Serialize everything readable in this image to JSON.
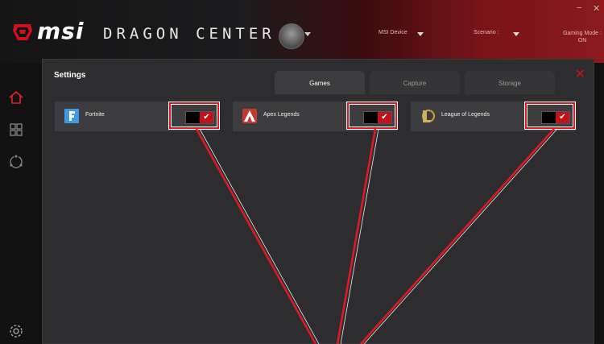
{
  "header": {
    "brand": "msi",
    "app_title": "DRAGON CENTER",
    "device_label": "MSI Device",
    "scenario_label": "Scenario :",
    "gaming_mode_label": "Gaming Mode :",
    "gaming_mode_value": "ON",
    "minimize": "−",
    "close": "✕"
  },
  "sidebar": {
    "icons": [
      "home-icon",
      "grid-icon",
      "refresh-icon",
      "settings-gear-icon"
    ],
    "active_color": "#e0202a"
  },
  "settings": {
    "title": "Settings",
    "close_glyph": "✕",
    "tabs": [
      {
        "label": "Games",
        "active": true
      },
      {
        "label": "Capture",
        "active": false
      },
      {
        "label": "Storage",
        "active": false
      }
    ],
    "games": [
      {
        "name": "Fortnite",
        "icon": "fortnite-icon",
        "enabled": true
      },
      {
        "name": "Apex Legends",
        "icon": "apex-legends-icon",
        "enabled": true
      },
      {
        "name": "League of Legends",
        "icon": "league-of-legends-icon",
        "enabled": true
      }
    ],
    "toggle_check": "✔"
  },
  "colors": {
    "accent": "#c1121b",
    "highlight": "#e01a22",
    "panel": "#2d2d2f",
    "card": "#3d3d3f"
  }
}
